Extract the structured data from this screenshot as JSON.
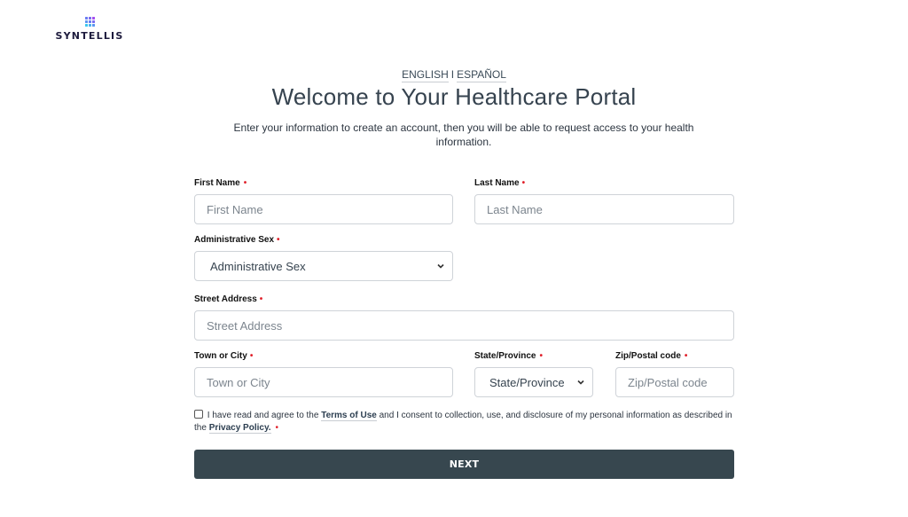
{
  "brand": {
    "name": "SYNTELLIS",
    "logo_icon": "dot-grid-logo-icon",
    "logo_colors": [
      "#6a7cf2",
      "#7b6cf0",
      "#a34df0",
      "#5e95f0",
      "#6a7cf2",
      "#7b6cf0",
      "#3cc6ee",
      "#4ab0ee",
      "#5a95f0"
    ]
  },
  "language": {
    "english": "ENGLISH",
    "separator": "I",
    "spanish": "ESPAÑOL"
  },
  "header": {
    "title": "Welcome to Your Healthcare Portal",
    "intro": "Enter your information to create an account, then you will be able to request access to your health information."
  },
  "form": {
    "required_marker": "•",
    "first_name": {
      "label": "First Name",
      "placeholder": "First Name",
      "value": ""
    },
    "last_name": {
      "label": "Last Name",
      "placeholder": "Last Name",
      "value": ""
    },
    "administrative_sex": {
      "label": "Administrative Sex",
      "selected": "Administrative Sex"
    },
    "street_address": {
      "label": "Street Address",
      "placeholder": "Street Address",
      "value": ""
    },
    "town_city": {
      "label": "Town or City",
      "placeholder": "Town or City",
      "value": ""
    },
    "state_province": {
      "label": "State/Province",
      "selected": "State/Province"
    },
    "zip": {
      "label": "Zip/Postal code",
      "placeholder": "Zip/Postal code",
      "value": ""
    }
  },
  "consent": {
    "checked": false,
    "text_before": "I have read and agree to the",
    "terms_link": "Terms of Use",
    "text_middle": "and I consent to collection, use, and disclosure of my personal information as described in the",
    "privacy_link": "Privacy Policy."
  },
  "actions": {
    "next_label": "NEXT"
  },
  "colors": {
    "button_bg": "#37474f",
    "required": "#e0202a",
    "title": "#36434f"
  }
}
